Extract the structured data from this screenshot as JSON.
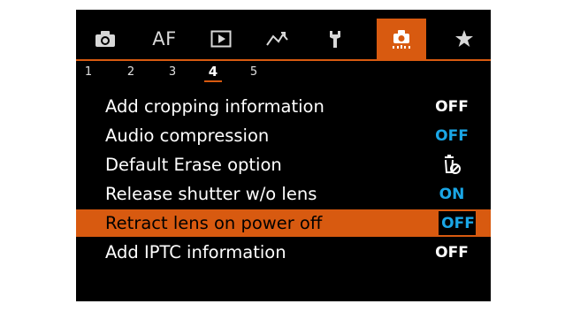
{
  "tabs": [
    {
      "icon": "camera-icon"
    },
    {
      "label": "AF"
    },
    {
      "icon": "playback-icon"
    },
    {
      "icon": "wireless-icon"
    },
    {
      "icon": "wrench-icon"
    },
    {
      "icon": "custom-functions-icon",
      "active": true
    },
    {
      "icon": "star-icon"
    }
  ],
  "subtabs": [
    "1",
    "2",
    "3",
    "4",
    "5"
  ],
  "active_subtab": "4",
  "menu": [
    {
      "label": "Add cropping information",
      "value": "OFF"
    },
    {
      "label": "Audio compression",
      "value": "OFF",
      "value_color": "blue"
    },
    {
      "label": "Default Erase option",
      "value_icon": "erase-cancel-icon"
    },
    {
      "label": "Release shutter w/o lens",
      "value": "ON",
      "value_color": "blue"
    },
    {
      "label": "Retract lens on power off",
      "value": "OFF",
      "value_color": "blue",
      "selected": true
    },
    {
      "label": "Add IPTC information",
      "value": "OFF"
    }
  ],
  "colors": {
    "accent": "#d85a10",
    "value_blue": "#1aa6e6",
    "background": "#000000",
    "text": "#ffffff"
  }
}
